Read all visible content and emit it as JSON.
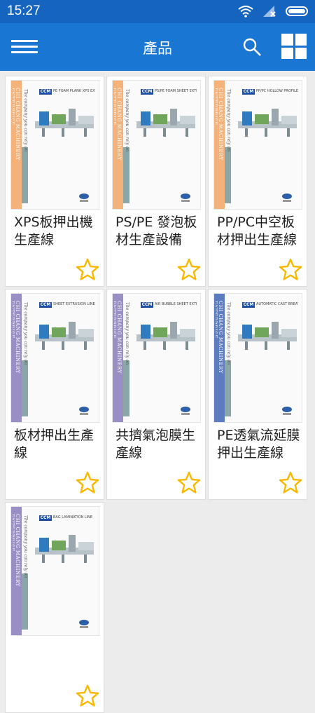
{
  "status": {
    "time": "15:27"
  },
  "appbar": {
    "title": "產品"
  },
  "products": [
    {
      "name": "XPS板押出機生產線",
      "cover_color": "#f4b27a",
      "cover_text": "CHI CHANG MACHINERY ENTERPRISE",
      "cover_sub": "PE FOAM PLANK XPS EXTRUSION LINE",
      "logo": "CCM",
      "slogan": "The company you can rely on"
    },
    {
      "name": "PS/PE 發泡板材生產設備",
      "cover_color": "#f4b27a",
      "cover_text": "CHI CHANG MACHINERY ENTERPRISE",
      "cover_sub": "PS/PE FOAM SHEET EXTRUSION LINE",
      "logo": "CCM",
      "slogan": "The company you can rely on"
    },
    {
      "name": "PP/PC中空板材押出生產線",
      "cover_color": "#f4b27a",
      "cover_text": "CHI CHANG MACHINERY ENTERPRISE",
      "cover_sub": "PP/PC HOLLOW PROFILE SHEET EXTRUSION LINE",
      "logo": "CCM",
      "slogan": "The company you can rely on"
    },
    {
      "name": "板材押出生產線",
      "cover_color": "#9a8fc4",
      "cover_text": "CHI CHANG MACHINERY ENTERPRISE",
      "cover_sub": "SHEET EXTRUSION LINE",
      "logo": "CCM",
      "slogan": "The company you can rely on"
    },
    {
      "name": "共擠氣泡膜生產線",
      "cover_color": "#9a8fc4",
      "cover_text": "CHI CHANG MACHINERY ENTERPRISE",
      "cover_sub": "AIR BUBBLE SHEET EXTRUSION LINE",
      "logo": "CCM",
      "slogan": "The company you can rely on"
    },
    {
      "name": "PE透氣流延膜押出生產線",
      "cover_color": "#5c7cc0",
      "cover_text": "CHI CHANG MACHINERY ENTERPRISE",
      "cover_sub": "AUTOMATIC CAST BREATHABLE FILM EXTRUSION LINE",
      "logo": "CCM",
      "slogan": "The company you can rely on"
    },
    {
      "name": "",
      "cover_color": "#9a8fc4",
      "cover_text": "CHI CHANG MACHINERY ENTERPRISE",
      "cover_sub": "BAG LAMINATION LINE",
      "logo": "CCM",
      "slogan": "The company you can rely on"
    }
  ],
  "colors": {
    "statusbar": "#1565c0",
    "appbar": "#1976d2",
    "star": "#f9b800"
  },
  "icons": {
    "menu": "hamburger-icon",
    "search": "search-icon",
    "grid": "grid-view-icon",
    "favorite": "star-outline-icon"
  }
}
